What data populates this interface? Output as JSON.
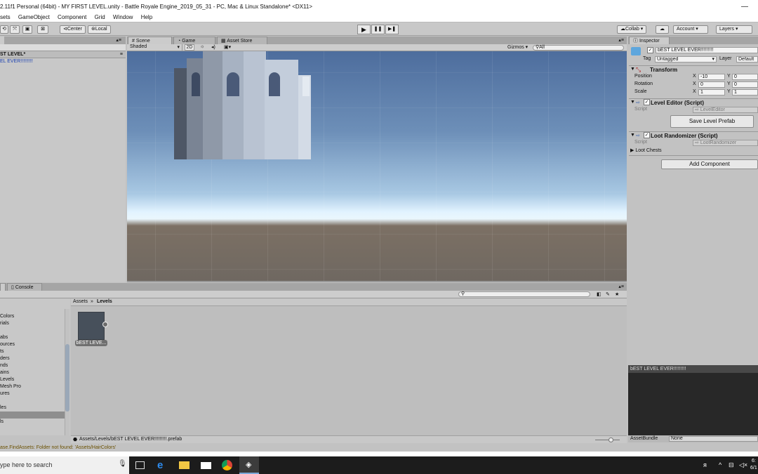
{
  "window": {
    "title": "2.11f1 Personal (64bit) - MY FIRST LEVEL.unity - Battle Royale Engine_2019_05_31 - PC, Mac & Linux Standalone* <DX11>",
    "minimize": "—"
  },
  "menu": [
    "sets",
    "GameObject",
    "Component",
    "Grid",
    "Window",
    "Help"
  ],
  "toolbar": {
    "pivot": "Center",
    "space": "Local",
    "collab": "Collab",
    "account": "Account",
    "layers": "Layers",
    "play_icon": "▶",
    "pause_icon": "❚❚",
    "step_icon": "▶❚"
  },
  "hierarchy": {
    "search_placeholder": "",
    "scene_name": "ST LEVEL*",
    "items": [
      "EL EVER!!!!!!!!!"
    ]
  },
  "scene_tabs": {
    "scene": "Scene",
    "game": "Game",
    "asset_store": "Asset Store",
    "shading": "Shaded",
    "mode_2d": "2D",
    "gizmos": "Gizmos",
    "search_placeholder": "All"
  },
  "inspector": {
    "tab": "Inspector",
    "object_name": "bEST LEVEL EVER!!!!!!!!!",
    "tag_label": "Tag",
    "tag_value": "Untagged",
    "layer_label": "Layer",
    "layer_value": "Default",
    "transform": {
      "title": "Transform",
      "position_label": "Position",
      "position_x": "-10",
      "position_y": "0",
      "rotation_label": "Rotation",
      "rotation_x": "0",
      "rotation_y": "0",
      "scale_label": "Scale",
      "scale_x": "1",
      "scale_y": "1",
      "x": "X",
      "y": "Y"
    },
    "level_editor": {
      "title": "Level Editor (Script)",
      "script_label": "Script",
      "script_value": "LevelEditor",
      "button": "Save Level Prefab"
    },
    "loot_randomizer": {
      "title": "Loot Randomizer (Script)",
      "script_label": "Script",
      "script_value": "LootRandomizer",
      "loot_chests": "Loot Chests"
    },
    "add_component": "Add Component"
  },
  "preview": {
    "title": "bEST LEVEL EVER!!!!!!!!!",
    "assetbundle_label": "AssetBundle",
    "assetbundle_value": "None"
  },
  "project": {
    "tab_console": "Console",
    "breadcrumb_root": "Assets",
    "breadcrumb_sep": "»",
    "breadcrumb_current": "Levels",
    "folders": [
      "Colors",
      "rials",
      "",
      "abs",
      "ources",
      "ts",
      "ders",
      "nds",
      "ains",
      "Levels",
      "Mesh Pro",
      "ures",
      "",
      "les",
      "",
      "ls"
    ],
    "asset_name": "bEST LEVE...",
    "path": "Assets/Levels/bEST LEVEL EVER!!!!!!!!!.prefab"
  },
  "status": "ase.FindAssets: Folder not found: 'Assets/HairColors'",
  "taskbar": {
    "search_placeholder": "ype here to search",
    "clock_time": "6:",
    "clock_date": "6/1"
  }
}
